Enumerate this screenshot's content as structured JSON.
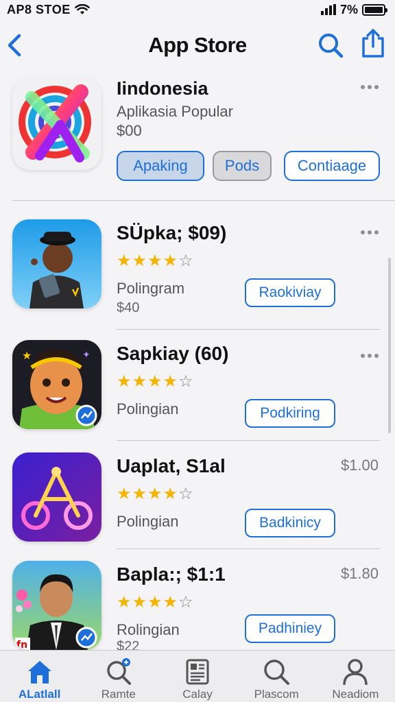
{
  "status": {
    "carrier": "AP8 STOE",
    "battery": "7%"
  },
  "nav": {
    "title": "App Store",
    "back_icon": "chevron-left-icon",
    "search_icon": "search-icon",
    "share_icon": "share-icon"
  },
  "featured": {
    "title": "Iindonesia",
    "subtitle": "Aplikasia Popular",
    "price": "$00",
    "buttons": [
      "Apaking",
      "Pods",
      "Contiaage"
    ]
  },
  "apps": [
    {
      "name": "SÜpka; $09)",
      "rating": 4,
      "developer": "Polingram",
      "price_below": "$40",
      "price_right": "",
      "button": "Raokiviay",
      "has_more": true
    },
    {
      "name": "Sapkiay (60)",
      "rating": 4,
      "developer": "Polingian",
      "price_below": "",
      "price_right": "",
      "button": "Podkiring",
      "has_more": true
    },
    {
      "name": "Uaplat, S1al",
      "rating": 4,
      "developer": "Polingian",
      "price_below": "",
      "price_right": "$1.00",
      "button": "Badkinicy",
      "has_more": false
    },
    {
      "name": "Bapla:; $1:1",
      "rating": 4,
      "developer": "Rolingian",
      "price_below": "$22",
      "price_right": "$1.80",
      "button": "Padhiniey",
      "has_more": false
    }
  ],
  "tabs": [
    {
      "label": "ALatlall",
      "icon": "home-icon",
      "active": true
    },
    {
      "label": "Ramte",
      "icon": "search-badge-icon",
      "active": false
    },
    {
      "label": "Calay",
      "icon": "document-icon",
      "active": false
    },
    {
      "label": "Plascom",
      "icon": "search-icon",
      "active": false
    },
    {
      "label": "Neadiom",
      "icon": "person-icon",
      "active": false
    }
  ],
  "colors": {
    "accent": "#1e6fd9",
    "star": "#f5b400",
    "background": "#f4f4f6"
  }
}
